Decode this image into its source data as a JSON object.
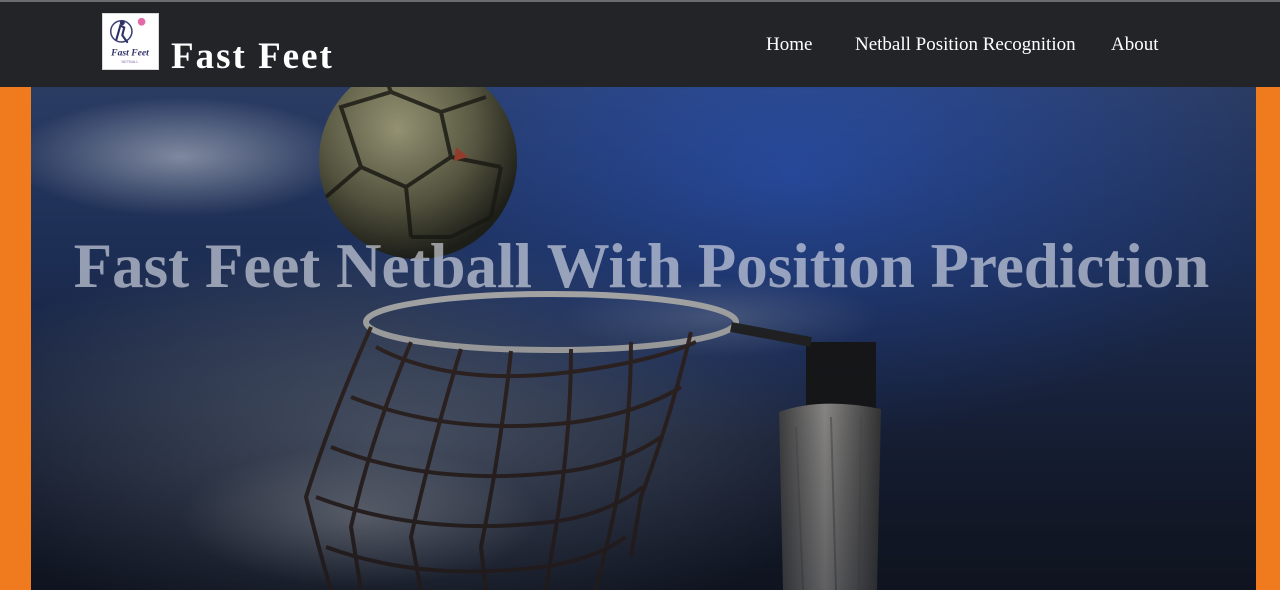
{
  "header": {
    "brand": "Fast Feet",
    "logo_text": "Fast Feet",
    "logo_subtext": "NETBALL"
  },
  "nav": {
    "items": [
      {
        "label": "Home"
      },
      {
        "label": "Netball Position Recognition"
      },
      {
        "label": "About"
      }
    ]
  },
  "hero": {
    "title": "Fast Feet Netball With Position Prediction"
  },
  "colors": {
    "navbar_bg": "#232428",
    "page_side_accent": "#f07a1e",
    "nav_text": "#ffffff",
    "hero_blue": "#1f3a8a"
  },
  "icons": {
    "logo": "netball-player-logo-icon"
  }
}
